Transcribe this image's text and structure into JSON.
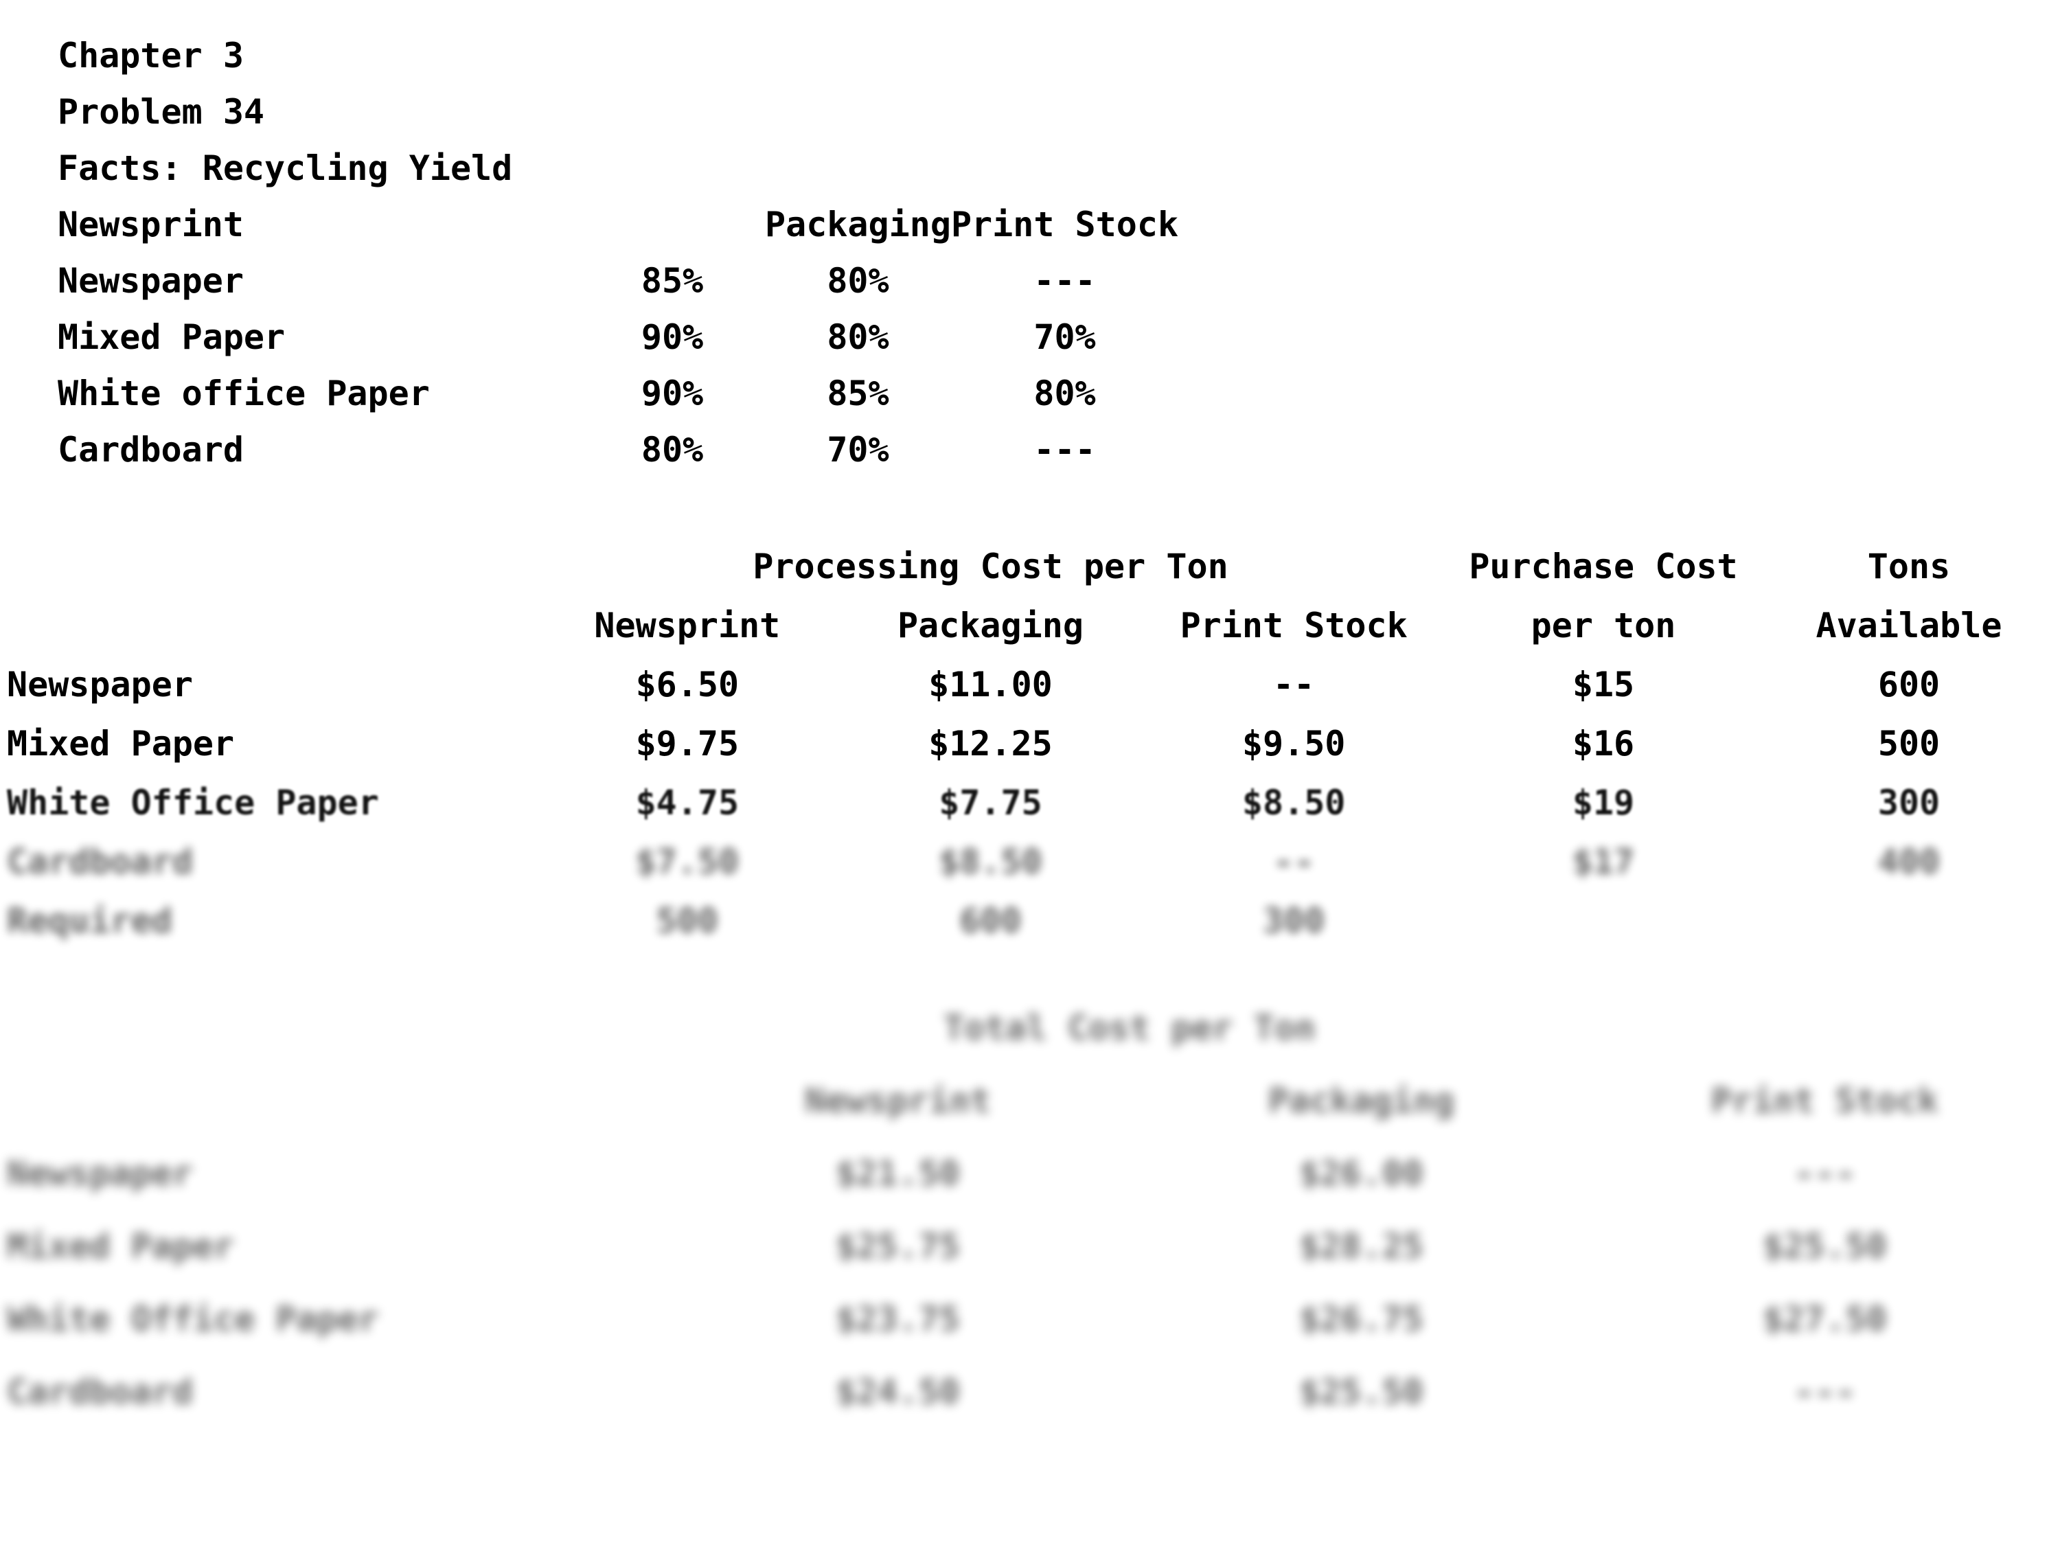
{
  "document": {
    "title_lines": [
      "Chapter 3",
      "Problem 34",
      "Facts: Recycling Yield"
    ]
  },
  "yield_table": {
    "headers": {
      "row_label": "Newsprint",
      "newsprint": "",
      "packaging": "Packaging",
      "print_stock": "Print Stock"
    },
    "rows": [
      {
        "label": "Newspaper",
        "newsprint": "85%",
        "packaging": "80%",
        "print_stock": "---"
      },
      {
        "label": "Mixed Paper",
        "newsprint": "90%",
        "packaging": "80%",
        "print_stock": "70%"
      },
      {
        "label": "White office Paper",
        "newsprint": "90%",
        "packaging": "85%",
        "print_stock": "80%"
      },
      {
        "label": "Cardboard",
        "newsprint": "80%",
        "packaging": "70%",
        "print_stock": "---"
      }
    ]
  },
  "cost_table": {
    "group_header": "Processing Cost per Ton",
    "headers": {
      "row_label": "",
      "newsprint": "Newsprint",
      "packaging": "Packaging",
      "print_stock": "Print Stock",
      "purchase_cost_line1": "Purchase Cost",
      "purchase_cost_line2": "per ton",
      "tons_line1": "Tons",
      "tons_line2": "Available"
    },
    "rows": [
      {
        "label": "Newspaper",
        "newsprint": "$6.50",
        "packaging": "$11.00",
        "print_stock": "--",
        "purchase_cost": "$15",
        "tons_available": "600"
      },
      {
        "label": "Mixed Paper",
        "newsprint": "$9.75",
        "packaging": "$12.25",
        "print_stock": "$9.50",
        "purchase_cost": "$16",
        "tons_available": "500"
      },
      {
        "label": "White Office Paper",
        "newsprint": "$4.75",
        "packaging": "$7.75",
        "print_stock": "$8.50",
        "purchase_cost": "$19",
        "tons_available": "300"
      },
      {
        "label": "Cardboard",
        "newsprint": "$7.50",
        "packaging": "$8.50",
        "print_stock": "--",
        "purchase_cost": "$17",
        "tons_available": "400"
      },
      {
        "label": "Required",
        "newsprint": "500",
        "packaging": "600",
        "print_stock": "300",
        "purchase_cost": "",
        "tons_available": ""
      }
    ]
  },
  "total_cost_table": {
    "group_header": "Total Cost per Ton",
    "headers": {
      "row_label": "",
      "newsprint": "Newsprint",
      "packaging": "Packaging",
      "print_stock": "Print Stock"
    },
    "rows": [
      {
        "label": "Newspaper",
        "newsprint": "$21.50",
        "packaging": "$26.00",
        "print_stock": "---"
      },
      {
        "label": "Mixed Paper",
        "newsprint": "$25.75",
        "packaging": "$28.25",
        "print_stock": "$25.50"
      },
      {
        "label": "White Office Paper",
        "newsprint": "$23.75",
        "packaging": "$26.75",
        "print_stock": "$27.50"
      },
      {
        "label": "Cardboard",
        "newsprint": "$24.50",
        "packaging": "$25.50",
        "print_stock": "---"
      }
    ]
  },
  "colors": {
    "page_background": "#ffffff",
    "text": "#000000"
  }
}
